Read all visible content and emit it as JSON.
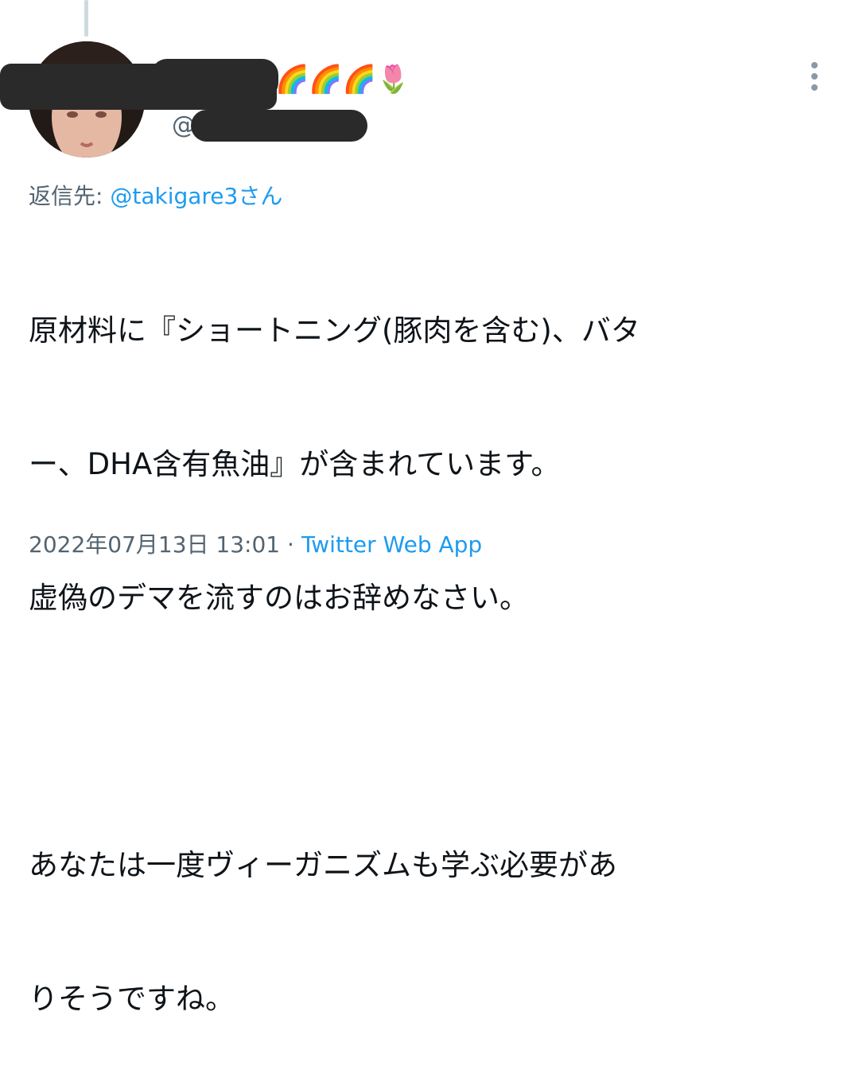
{
  "tweet": {
    "author": {
      "display_name_emoji": "🌈🌈🌈🌷",
      "handle_prefix": "@"
    },
    "reply_to": {
      "prefix": "返信先: ",
      "target": "@takigare3さん"
    },
    "body_lines": [
      "原材料に『ショートニング(豚肉を含む)、バタ",
      "ー、DHA含有魚油』が含まれています。",
      "虚偽のデマを流すのはお辞めなさい。",
      "",
      "あなたは一度ヴィーガニズムも学ぶ必要があ",
      "りそうですね。"
    ],
    "timestamp": "2022年07月13日 13:01",
    "separator": " · ",
    "source": "Twitter Web App"
  },
  "icons": {
    "more": "more-vertical-icon",
    "avatar": "avatar-image"
  }
}
